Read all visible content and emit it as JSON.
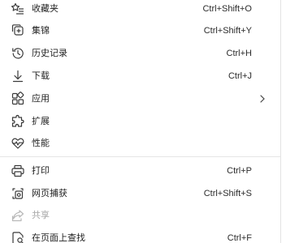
{
  "menu": {
    "items": [
      {
        "label": "收藏夹",
        "shortcut": "Ctrl+Shift+O",
        "icon": "favorites-icon"
      },
      {
        "label": "集锦",
        "shortcut": "Ctrl+Shift+Y",
        "icon": "collections-icon"
      },
      {
        "label": "历史记录",
        "shortcut": "Ctrl+H",
        "icon": "history-icon"
      },
      {
        "label": "下载",
        "shortcut": "Ctrl+J",
        "icon": "download-icon"
      },
      {
        "label": "应用",
        "shortcut": "",
        "icon": "apps-icon",
        "submenu": true
      },
      {
        "label": "扩展",
        "shortcut": "",
        "icon": "extensions-icon"
      },
      {
        "label": "性能",
        "shortcut": "",
        "icon": "performance-icon"
      },
      {
        "label": "打印",
        "shortcut": "Ctrl+P",
        "icon": "print-icon"
      },
      {
        "label": "网页捕获",
        "shortcut": "Ctrl+Shift+S",
        "icon": "web-capture-icon"
      },
      {
        "label": "共享",
        "shortcut": "",
        "icon": "share-icon",
        "disabled": true
      },
      {
        "label": "在页面上查找",
        "shortcut": "Ctrl+F",
        "icon": "find-icon"
      }
    ]
  }
}
